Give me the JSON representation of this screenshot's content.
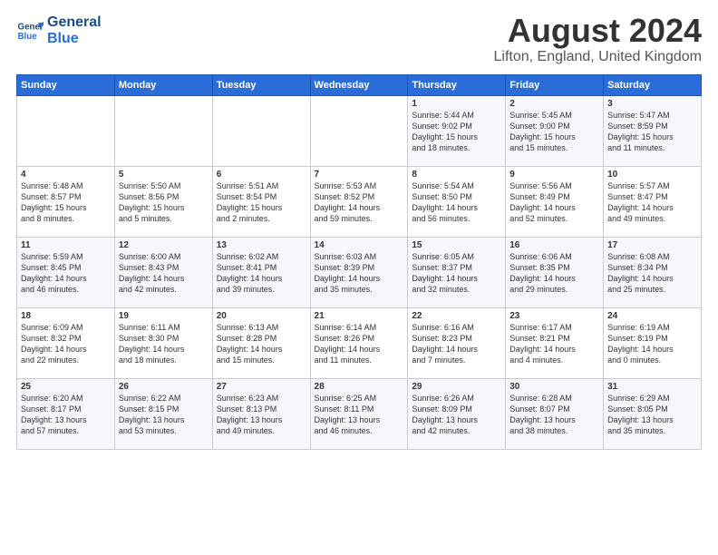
{
  "logo": {
    "line1": "General",
    "line2": "Blue"
  },
  "title": "August 2024",
  "location": "Lifton, England, United Kingdom",
  "headers": [
    "Sunday",
    "Monday",
    "Tuesday",
    "Wednesday",
    "Thursday",
    "Friday",
    "Saturday"
  ],
  "weeks": [
    [
      {
        "day": "",
        "text": ""
      },
      {
        "day": "",
        "text": ""
      },
      {
        "day": "",
        "text": ""
      },
      {
        "day": "",
        "text": ""
      },
      {
        "day": "1",
        "text": "Sunrise: 5:44 AM\nSunset: 9:02 PM\nDaylight: 15 hours\nand 18 minutes."
      },
      {
        "day": "2",
        "text": "Sunrise: 5:45 AM\nSunset: 9:00 PM\nDaylight: 15 hours\nand 15 minutes."
      },
      {
        "day": "3",
        "text": "Sunrise: 5:47 AM\nSunset: 8:59 PM\nDaylight: 15 hours\nand 11 minutes."
      }
    ],
    [
      {
        "day": "4",
        "text": "Sunrise: 5:48 AM\nSunset: 8:57 PM\nDaylight: 15 hours\nand 8 minutes."
      },
      {
        "day": "5",
        "text": "Sunrise: 5:50 AM\nSunset: 8:56 PM\nDaylight: 15 hours\nand 5 minutes."
      },
      {
        "day": "6",
        "text": "Sunrise: 5:51 AM\nSunset: 8:54 PM\nDaylight: 15 hours\nand 2 minutes."
      },
      {
        "day": "7",
        "text": "Sunrise: 5:53 AM\nSunset: 8:52 PM\nDaylight: 14 hours\nand 59 minutes."
      },
      {
        "day": "8",
        "text": "Sunrise: 5:54 AM\nSunset: 8:50 PM\nDaylight: 14 hours\nand 56 minutes."
      },
      {
        "day": "9",
        "text": "Sunrise: 5:56 AM\nSunset: 8:49 PM\nDaylight: 14 hours\nand 52 minutes."
      },
      {
        "day": "10",
        "text": "Sunrise: 5:57 AM\nSunset: 8:47 PM\nDaylight: 14 hours\nand 49 minutes."
      }
    ],
    [
      {
        "day": "11",
        "text": "Sunrise: 5:59 AM\nSunset: 8:45 PM\nDaylight: 14 hours\nand 46 minutes."
      },
      {
        "day": "12",
        "text": "Sunrise: 6:00 AM\nSunset: 8:43 PM\nDaylight: 14 hours\nand 42 minutes."
      },
      {
        "day": "13",
        "text": "Sunrise: 6:02 AM\nSunset: 8:41 PM\nDaylight: 14 hours\nand 39 minutes."
      },
      {
        "day": "14",
        "text": "Sunrise: 6:03 AM\nSunset: 8:39 PM\nDaylight: 14 hours\nand 35 minutes."
      },
      {
        "day": "15",
        "text": "Sunrise: 6:05 AM\nSunset: 8:37 PM\nDaylight: 14 hours\nand 32 minutes."
      },
      {
        "day": "16",
        "text": "Sunrise: 6:06 AM\nSunset: 8:35 PM\nDaylight: 14 hours\nand 29 minutes."
      },
      {
        "day": "17",
        "text": "Sunrise: 6:08 AM\nSunset: 8:34 PM\nDaylight: 14 hours\nand 25 minutes."
      }
    ],
    [
      {
        "day": "18",
        "text": "Sunrise: 6:09 AM\nSunset: 8:32 PM\nDaylight: 14 hours\nand 22 minutes."
      },
      {
        "day": "19",
        "text": "Sunrise: 6:11 AM\nSunset: 8:30 PM\nDaylight: 14 hours\nand 18 minutes."
      },
      {
        "day": "20",
        "text": "Sunrise: 6:13 AM\nSunset: 8:28 PM\nDaylight: 14 hours\nand 15 minutes."
      },
      {
        "day": "21",
        "text": "Sunrise: 6:14 AM\nSunset: 8:26 PM\nDaylight: 14 hours\nand 11 minutes."
      },
      {
        "day": "22",
        "text": "Sunrise: 6:16 AM\nSunset: 8:23 PM\nDaylight: 14 hours\nand 7 minutes."
      },
      {
        "day": "23",
        "text": "Sunrise: 6:17 AM\nSunset: 8:21 PM\nDaylight: 14 hours\nand 4 minutes."
      },
      {
        "day": "24",
        "text": "Sunrise: 6:19 AM\nSunset: 8:19 PM\nDaylight: 14 hours\nand 0 minutes."
      }
    ],
    [
      {
        "day": "25",
        "text": "Sunrise: 6:20 AM\nSunset: 8:17 PM\nDaylight: 13 hours\nand 57 minutes."
      },
      {
        "day": "26",
        "text": "Sunrise: 6:22 AM\nSunset: 8:15 PM\nDaylight: 13 hours\nand 53 minutes."
      },
      {
        "day": "27",
        "text": "Sunrise: 6:23 AM\nSunset: 8:13 PM\nDaylight: 13 hours\nand 49 minutes."
      },
      {
        "day": "28",
        "text": "Sunrise: 6:25 AM\nSunset: 8:11 PM\nDaylight: 13 hours\nand 46 minutes."
      },
      {
        "day": "29",
        "text": "Sunrise: 6:26 AM\nSunset: 8:09 PM\nDaylight: 13 hours\nand 42 minutes."
      },
      {
        "day": "30",
        "text": "Sunrise: 6:28 AM\nSunset: 8:07 PM\nDaylight: 13 hours\nand 38 minutes."
      },
      {
        "day": "31",
        "text": "Sunrise: 6:29 AM\nSunset: 8:05 PM\nDaylight: 13 hours\nand 35 minutes."
      }
    ]
  ]
}
